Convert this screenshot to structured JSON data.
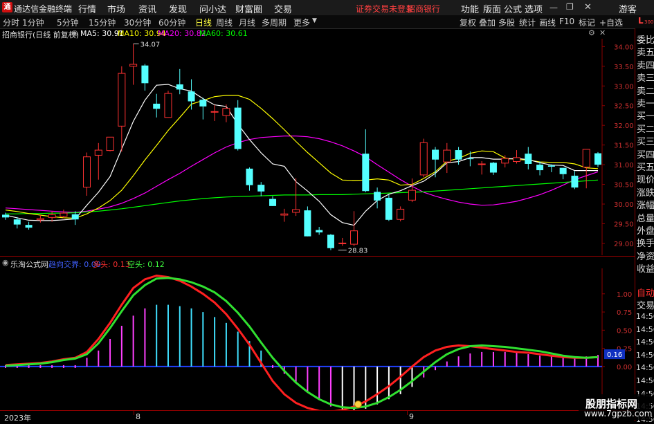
{
  "title_bar": {
    "app_name": "通达信金融终端",
    "menus": [
      "行情",
      "市场",
      "资讯",
      "发现",
      "问小达",
      "财富圈",
      "交易"
    ],
    "notice": "证券交易未登录",
    "broker": "招商银行",
    "right_menus": [
      "功能",
      "版面",
      "公式",
      "选项"
    ],
    "guest": "游客"
  },
  "toolbar": {
    "periods": [
      "分时",
      "1分钟",
      "5分钟",
      "15分钟",
      "30分钟",
      "60分钟",
      "日线",
      "周线",
      "月线",
      "多周期",
      "更多"
    ],
    "active_period": "日线",
    "right_buttons": [
      "复权",
      "叠加",
      "多股",
      "统计",
      "画线",
      "F10",
      "标记",
      "+自选"
    ]
  },
  "info_line": {
    "stock": "招商银行(日线 前复权)",
    "ma5": "MA5: 30.91",
    "ma10": "MA10: 30.94",
    "ma20": "MA20: 30.82",
    "ma60": "MA60: 30.61"
  },
  "indicator_line": {
    "name": "乐淘公式网",
    "label1": "趋向交界: 0.00",
    "label2": "多头: 0.13",
    "label3": "空头: 0.12"
  },
  "right_panel": {
    "items": [
      "委比",
      "卖五",
      "卖四",
      "卖三",
      "卖二",
      "卖一",
      "买一",
      "买二",
      "买三",
      "买四",
      "买五",
      "现价",
      "涨跌",
      "涨幅",
      "总量",
      "外盘",
      "换手",
      "净资",
      "收益"
    ],
    "tab_auto": "自动",
    "tab_trade": "交易",
    "times": [
      "14:56",
      "14:56",
      "14:56",
      "14:56",
      "14:56",
      "14:56",
      "14:56",
      "14:56",
      "14:56"
    ],
    "header_L": "L",
    "header_num": "300"
  },
  "price_axis": [
    "34.00",
    "33.50",
    "33.00",
    "32.50",
    "32.00",
    "31.50",
    "31.00",
    "30.50",
    "30.00",
    "29.50",
    "29.00"
  ],
  "ind_axis": [
    "1.00",
    "0.75",
    "0.50",
    "0.25",
    "0.00"
  ],
  "ind_current": "0.16",
  "annotations": {
    "high": "34.07",
    "low": "28.83"
  },
  "date_labels": [
    "2023年",
    "8",
    "9"
  ],
  "watermark": {
    "line1": "股朋指标网",
    "line2": "www.7gpzb.com"
  },
  "colors": {
    "up": "#ff3232",
    "down": "#54ffff",
    "ma5": "#ffffff",
    "ma10": "#ffff00",
    "ma20": "#ff00ff",
    "ma60": "#00ff00"
  },
  "chart_data": [
    {
      "type": "candlestick",
      "title": "招商银行(日线 前复权)",
      "ylim": [
        28.7,
        34.2
      ],
      "candles": [
        {
          "o": 29.73,
          "h": 29.78,
          "c": 29.66,
          "l": 29.6
        },
        {
          "o": 29.61,
          "h": 29.67,
          "c": 29.48,
          "l": 29.38
        },
        {
          "o": 29.47,
          "h": 29.55,
          "c": 29.4,
          "l": 29.35
        },
        {
          "o": 29.6,
          "h": 29.72,
          "c": 29.63,
          "l": 29.53
        },
        {
          "o": 29.66,
          "h": 29.82,
          "c": 29.73,
          "l": 29.55
        },
        {
          "o": 29.69,
          "h": 29.86,
          "c": 29.77,
          "l": 29.64
        },
        {
          "o": 29.74,
          "h": 29.82,
          "c": 29.61,
          "l": 29.47
        },
        {
          "o": 30.43,
          "h": 31.31,
          "c": 31.2,
          "l": 30.21
        },
        {
          "o": 31.24,
          "h": 31.55,
          "c": 31.37,
          "l": 30.62
        },
        {
          "o": 31.36,
          "h": 31.67,
          "c": 31.7,
          "l": 31.34
        },
        {
          "o": 31.98,
          "h": 33.5,
          "c": 33.32,
          "l": 31.33
        },
        {
          "o": 33.5,
          "h": 34.07,
          "c": 33.55,
          "l": 33.03
        },
        {
          "o": 33.52,
          "h": 33.56,
          "c": 33.07,
          "l": 32.88
        },
        {
          "o": 32.55,
          "h": 32.8,
          "c": 32.42,
          "l": 32.2
        },
        {
          "o": 32.2,
          "h": 32.88,
          "c": 32.81,
          "l": 32.55
        },
        {
          "o": 33.04,
          "h": 33.43,
          "c": 32.91,
          "l": 32.79
        },
        {
          "o": 32.86,
          "h": 33.17,
          "c": 32.61,
          "l": 32.4
        },
        {
          "o": 32.65,
          "h": 32.7,
          "c": 32.48,
          "l": 32.15
        },
        {
          "o": 32.34,
          "h": 32.52,
          "c": 32.35,
          "l": 32.11
        },
        {
          "o": 32.25,
          "h": 32.53,
          "c": 32.43,
          "l": 32.08
        },
        {
          "o": 32.45,
          "h": 32.64,
          "c": 31.4,
          "l": 31.36
        },
        {
          "o": 30.9,
          "h": 30.93,
          "c": 30.48,
          "l": 30.34
        },
        {
          "o": 30.49,
          "h": 30.56,
          "c": 30.32,
          "l": 30.2
        },
        {
          "o": 30.13,
          "h": 30.2,
          "c": 29.95,
          "l": 29.95
        },
        {
          "o": 29.72,
          "h": 29.88,
          "c": 29.75,
          "l": 29.55
        },
        {
          "o": 29.79,
          "h": 30.66,
          "c": 29.86,
          "l": 29.7
        },
        {
          "o": 29.84,
          "h": 29.94,
          "c": 29.18,
          "l": 29.18
        },
        {
          "o": 29.34,
          "h": 29.42,
          "c": 29.28,
          "l": 29.22
        },
        {
          "o": 29.22,
          "h": 29.24,
          "c": 28.88,
          "l": 28.83
        },
        {
          "o": 29.0,
          "h": 29.14,
          "c": 29.01,
          "l": 28.94
        },
        {
          "o": 28.98,
          "h": 29.82,
          "c": 29.32,
          "l": 28.93
        },
        {
          "o": 31.28,
          "h": 31.9,
          "c": 30.33,
          "l": 30.3
        },
        {
          "o": 30.31,
          "h": 30.42,
          "c": 30.09,
          "l": 29.89
        },
        {
          "o": 30.16,
          "h": 30.24,
          "c": 29.6,
          "l": 29.57
        },
        {
          "o": 29.61,
          "h": 29.94,
          "c": 29.87,
          "l": 29.56
        },
        {
          "o": 30.1,
          "h": 30.65,
          "c": 30.35,
          "l": 30.05
        },
        {
          "o": 30.74,
          "h": 31.66,
          "c": 31.56,
          "l": 30.68
        },
        {
          "o": 31.38,
          "h": 31.45,
          "c": 31.13,
          "l": 30.68
        },
        {
          "o": 31.07,
          "h": 31.55,
          "c": 31.37,
          "l": 30.79
        },
        {
          "o": 31.37,
          "h": 31.45,
          "c": 31.13,
          "l": 31.0
        },
        {
          "o": 31.16,
          "h": 31.34,
          "c": 31.14,
          "l": 30.96
        },
        {
          "o": 31.02,
          "h": 31.09,
          "c": 31.02,
          "l": 30.75
        },
        {
          "o": 31.05,
          "h": 31.07,
          "c": 30.8,
          "l": 30.74
        },
        {
          "o": 31.04,
          "h": 31.24,
          "c": 31.16,
          "l": 30.93
        },
        {
          "o": 31.08,
          "h": 31.37,
          "c": 31.18,
          "l": 31.03
        },
        {
          "o": 31.28,
          "h": 31.45,
          "c": 31.02,
          "l": 30.88
        },
        {
          "o": 31.0,
          "h": 31.08,
          "c": 30.86,
          "l": 30.73
        },
        {
          "o": 30.98,
          "h": 31.01,
          "c": 30.95,
          "l": 30.81
        },
        {
          "o": 30.92,
          "h": 30.92,
          "c": 30.76,
          "l": 30.63
        },
        {
          "o": 30.72,
          "h": 30.84,
          "c": 30.42,
          "l": 30.38
        },
        {
          "o": 30.94,
          "h": 31.37,
          "c": 31.39,
          "l": 30.4
        },
        {
          "o": 31.29,
          "h": 31.32,
          "c": 31.0,
          "l": 30.94
        }
      ],
      "series": [
        {
          "name": "MA5",
          "values": [
            29.72,
            29.65,
            29.59,
            29.58,
            29.58,
            29.6,
            29.62,
            29.97,
            30.3,
            30.7,
            31.4,
            32.1,
            32.64,
            33.02,
            33.04,
            32.93,
            32.87,
            32.68,
            32.52,
            32.48,
            32.03,
            31.64,
            31.3,
            31.02,
            30.96,
            30.57,
            30.33,
            30.07,
            29.73,
            29.53,
            29.46,
            29.82,
            30.09,
            30.25,
            30.34,
            30.47,
            30.58,
            30.78,
            31.05,
            31.08,
            31.18,
            31.18,
            31.14,
            31.14,
            31.16,
            31.13,
            31.05,
            30.99,
            30.98,
            30.85,
            30.85,
            30.85
          ]
        },
        {
          "name": "MA10",
          "values": [
            29.85,
            29.81,
            29.76,
            29.72,
            29.68,
            29.65,
            29.64,
            29.75,
            29.9,
            30.09,
            30.35,
            30.72,
            31.12,
            31.49,
            31.87,
            32.2,
            32.54,
            32.63,
            32.73,
            32.76,
            32.76,
            32.66,
            32.43,
            32.17,
            31.89,
            31.59,
            31.31,
            31.05,
            30.79,
            30.61,
            30.6,
            30.61,
            30.64,
            30.61,
            30.48,
            30.5,
            30.65,
            30.82,
            31.09,
            31.16,
            31.29,
            31.35,
            31.33,
            31.17,
            31.13,
            31.12,
            31.07,
            31.06,
            31.06,
            31.02,
            30.92,
            30.9
          ]
        },
        {
          "name": "MA20",
          "values": [
            29.9,
            29.88,
            29.86,
            29.84,
            29.82,
            29.8,
            29.79,
            29.82,
            29.87,
            29.93,
            30.02,
            30.14,
            30.28,
            30.45,
            30.62,
            30.78,
            30.96,
            31.13,
            31.3,
            31.45,
            31.56,
            31.64,
            31.69,
            31.71,
            31.73,
            31.73,
            31.71,
            31.66,
            31.58,
            31.48,
            31.35,
            31.2,
            31.0,
            30.81,
            30.62,
            30.45,
            30.3,
            30.2,
            30.12,
            30.05,
            30.0,
            29.97,
            29.98,
            30.02,
            30.07,
            30.15,
            30.24,
            30.35,
            30.48,
            30.62,
            30.72,
            30.82
          ]
        },
        {
          "name": "MA60",
          "values": [
            29.75,
            29.75,
            29.76,
            29.76,
            29.77,
            29.77,
            29.78,
            29.8,
            29.82,
            29.85,
            29.88,
            29.92,
            29.96,
            30.0,
            30.04,
            30.08,
            30.11,
            30.14,
            30.16,
            30.18,
            30.19,
            30.2,
            30.21,
            30.22,
            30.23,
            30.23,
            30.23,
            30.24,
            30.24,
            30.24,
            30.25,
            30.26,
            30.27,
            30.28,
            30.29,
            30.3,
            30.31,
            30.33,
            30.35,
            30.37,
            30.39,
            30.41,
            30.43,
            30.45,
            30.47,
            30.49,
            30.51,
            30.53,
            30.55,
            30.57,
            30.59,
            30.61
          ]
        }
      ]
    },
    {
      "type": "bar",
      "title": "乐淘公式网",
      "ylim": [
        -0.6,
        1.35
      ],
      "values": [
        0.0,
        0.0,
        0.0,
        0.0,
        0.0,
        0.0,
        0.0,
        0.12,
        0.22,
        0.38,
        0.56,
        0.7,
        0.8,
        0.85,
        0.85,
        0.83,
        0.8,
        0.75,
        0.68,
        0.6,
        0.48,
        0.35,
        0.22,
        0.0,
        -0.1,
        -0.22,
        -0.35,
        -0.45,
        -0.55,
        -0.62,
        -0.62,
        -0.58,
        -0.52,
        -0.45,
        -0.38,
        -0.28,
        -0.15,
        -0.05,
        0.07,
        0.14,
        0.18,
        0.2,
        0.2,
        0.2,
        0.19,
        0.17,
        0.15,
        0.14,
        0.13,
        0.12,
        0.14,
        0.16
      ],
      "series": [
        {
          "name": "多头",
          "values": [
            0.02,
            0.03,
            0.04,
            0.05,
            0.07,
            0.1,
            0.12,
            0.2,
            0.38,
            0.6,
            0.85,
            1.08,
            1.2,
            1.25,
            1.23,
            1.18,
            1.1,
            1.0,
            0.88,
            0.72,
            0.52,
            0.3,
            0.05,
            -0.2,
            -0.38,
            -0.5,
            -0.57,
            -0.61,
            -0.62,
            -0.6,
            -0.55,
            -0.48,
            -0.38,
            -0.27,
            -0.14,
            0.0,
            0.13,
            0.22,
            0.27,
            0.29,
            0.28,
            0.26,
            0.24,
            0.22,
            0.2,
            0.19,
            0.17,
            0.15,
            0.13,
            0.12,
            0.12,
            0.13
          ]
        },
        {
          "name": "空头",
          "values": [
            0.01,
            0.02,
            0.03,
            0.04,
            0.06,
            0.09,
            0.11,
            0.17,
            0.32,
            0.53,
            0.76,
            0.98,
            1.12,
            1.21,
            1.22,
            1.2,
            1.16,
            1.1,
            1.02,
            0.9,
            0.74,
            0.55,
            0.33,
            0.12,
            -0.06,
            -0.22,
            -0.35,
            -0.45,
            -0.52,
            -0.56,
            -0.57,
            -0.55,
            -0.5,
            -0.42,
            -0.32,
            -0.2,
            -0.07,
            0.06,
            0.17,
            0.24,
            0.28,
            0.29,
            0.28,
            0.27,
            0.25,
            0.23,
            0.21,
            0.18,
            0.15,
            0.13,
            0.12,
            0.13
          ]
        }
      ]
    }
  ]
}
